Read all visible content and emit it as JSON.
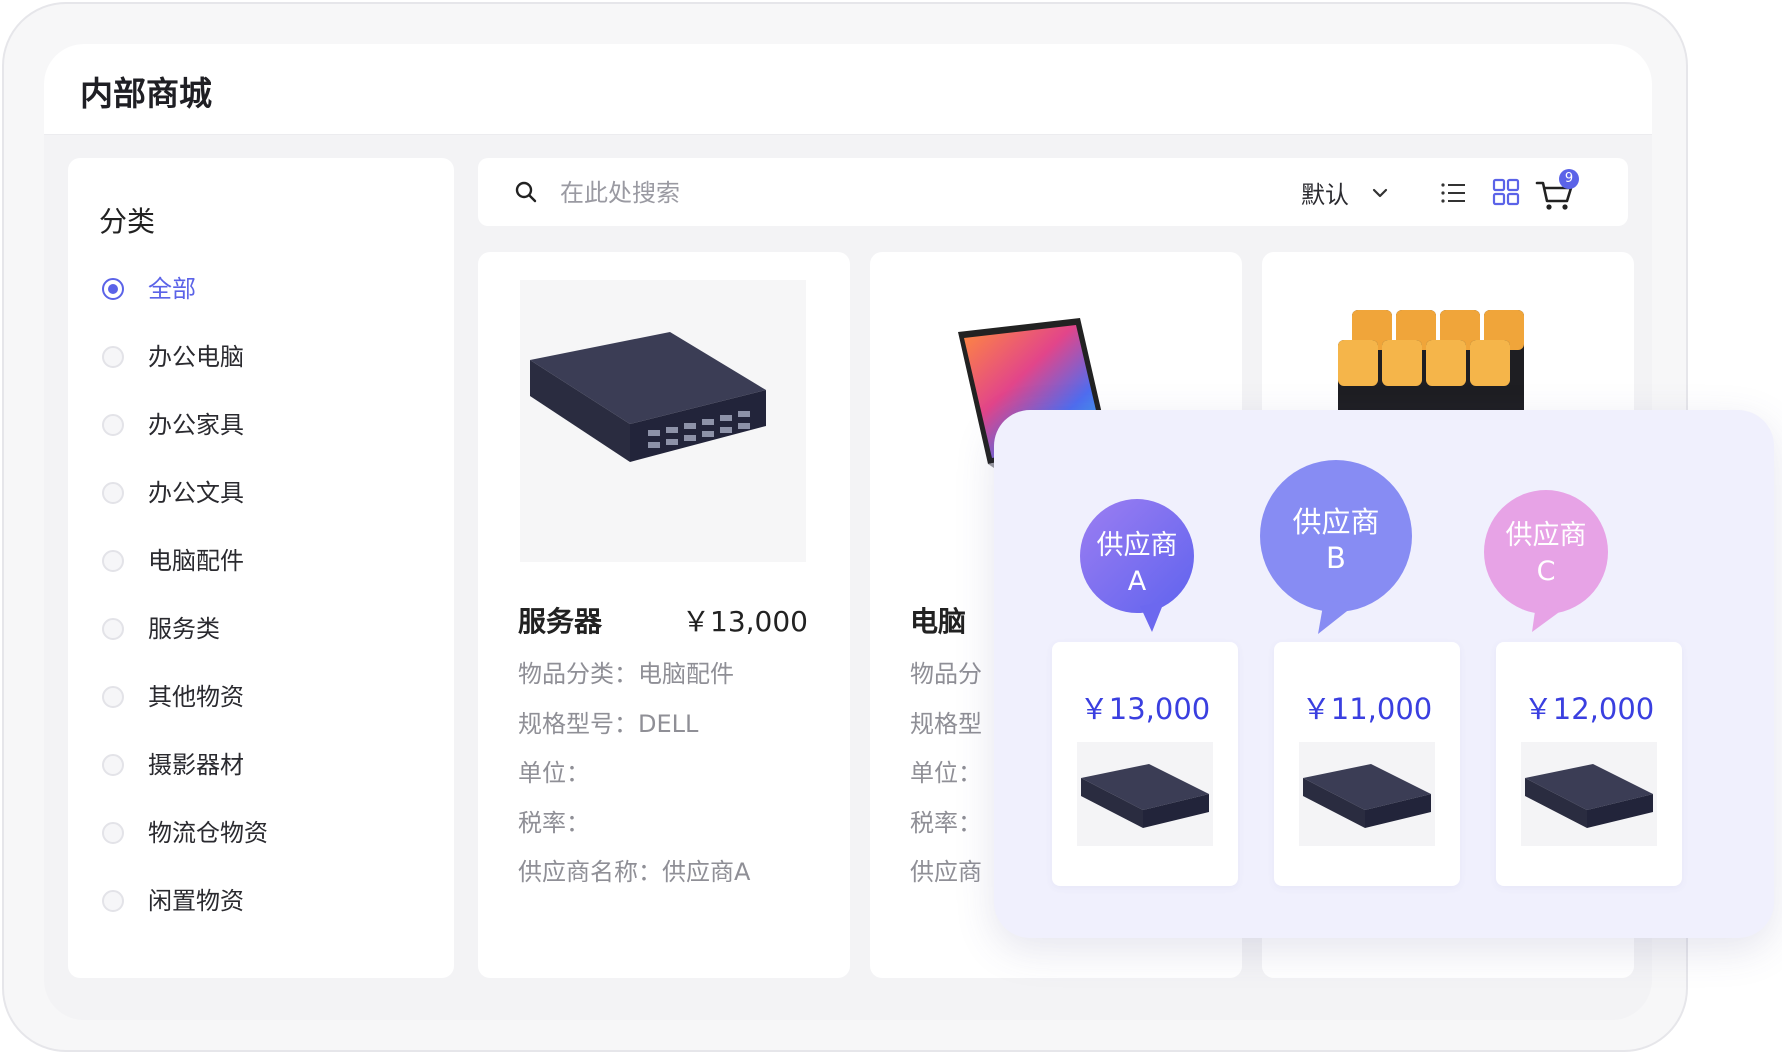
{
  "app": {
    "title": "内部商城"
  },
  "sidebar": {
    "title": "分类",
    "categories": [
      {
        "label": "全部",
        "selected": true
      },
      {
        "label": "办公电脑",
        "selected": false
      },
      {
        "label": "办公家具",
        "selected": false
      },
      {
        "label": "办公文具",
        "selected": false
      },
      {
        "label": "电脑配件",
        "selected": false
      },
      {
        "label": "服务类",
        "selected": false
      },
      {
        "label": "其他物资",
        "selected": false
      },
      {
        "label": "摄影器材",
        "selected": false
      },
      {
        "label": "物流仓物资",
        "selected": false
      },
      {
        "label": "闲置物资",
        "selected": false
      }
    ]
  },
  "toolbar": {
    "search_placeholder": "在此处搜索",
    "sort_label": "默认",
    "cart_count": "9",
    "icons": [
      "search-icon",
      "chevron-down-icon",
      "list-view-icon",
      "grid-view-icon",
      "cart-icon"
    ]
  },
  "products": [
    {
      "name": "服务器",
      "price": "￥13,000",
      "category": "物品分类：电脑配件",
      "model": "规格型号：DELL",
      "unit": "单位：",
      "tax": "税率：",
      "supplier": "供应商名称：供应商A"
    },
    {
      "name": "电脑",
      "category": "物品分",
      "model": "规格型",
      "unit": "单位：",
      "tax": "税率：",
      "supplier": "供应商"
    },
    {
      "name": ""
    }
  ],
  "comparison": {
    "suppliers": [
      {
        "line1": "供应商",
        "line2": "A",
        "price": "￥13,000"
      },
      {
        "line1": "供应商",
        "line2": "B",
        "price": "￥11,000"
      },
      {
        "line1": "供应商",
        "line2": "C",
        "price": "￥12,000"
      }
    ]
  },
  "colors": {
    "accent": "#5b63e8",
    "price_blue": "#3a3fe0",
    "bubble_a": "#7e74f0",
    "bubble_b": "#8a8df4",
    "bubble_c": "#e79fe4"
  }
}
